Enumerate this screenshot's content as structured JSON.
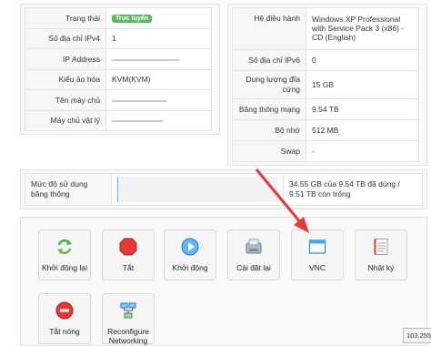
{
  "left_info": [
    {
      "label": "Trạng thái",
      "badge": "Trực tuyến"
    },
    {
      "label": "Số địa chỉ IPv4",
      "value": "1"
    },
    {
      "label": "IP Address",
      "value": ""
    },
    {
      "label": "Kiểu ảo hóa",
      "value": "KVM(KVM)"
    },
    {
      "label": "Tên máy chủ",
      "value": ""
    },
    {
      "label": "Máy chủ vật lý",
      "value": ""
    }
  ],
  "right_info": [
    {
      "label": "Hệ điều hành",
      "value": "Windows XP Professional with Service Pack 3 (x86) - CD (English)"
    },
    {
      "label": "Số địa chỉ IPv6",
      "value": "0"
    },
    {
      "label": "Dung lượng đĩa cứng",
      "value": "15 GB"
    },
    {
      "label": "Băng thông mạng",
      "value": "9.54 TB"
    },
    {
      "label": "Bộ nhớ",
      "value": "512 MB"
    },
    {
      "label": "Swap",
      "value": "-"
    }
  ],
  "bandwidth": {
    "label": "Mức độ sử dụng băng thông",
    "value": "34.55 GB của 9.54 TB đã dùng / 9.51 TB còn trống",
    "used_fraction": 0.0035
  },
  "actions": [
    {
      "label": "Khởi động lại",
      "icon": "restart-icon"
    },
    {
      "label": "Tắt",
      "icon": "stop-icon"
    },
    {
      "label": "Khởi động",
      "icon": "start-icon"
    },
    {
      "label": "Cài đặt lại",
      "icon": "reinstall-icon"
    },
    {
      "label": "VNC",
      "icon": "vnc-window-icon"
    },
    {
      "label": "Nhật ký",
      "icon": "log-icon"
    },
    {
      "label": "Tắt nóng",
      "icon": "power-off-icon"
    },
    {
      "label": "Reconfigure Networking",
      "icon": "network-icon"
    }
  ],
  "ip_tooltip": "103.255.",
  "colors": {
    "badge": "#5cb85c",
    "arrow": "#e53935",
    "border": "#e1e1e1"
  }
}
